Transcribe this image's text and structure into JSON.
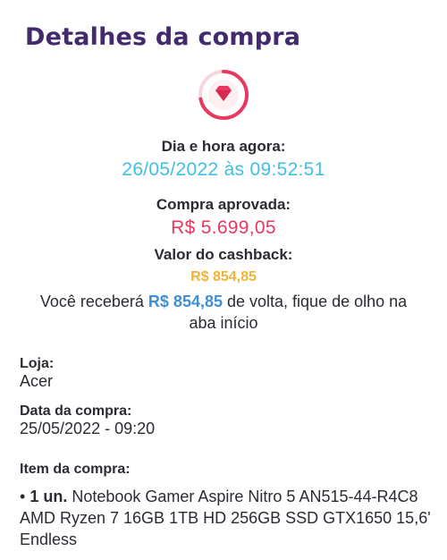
{
  "header": {
    "title": "Detalhes da compra"
  },
  "status_icon": {
    "name": "diamond-progress-icon",
    "color": "#e8385f",
    "track_color": "#f6d6dd",
    "progress": 0.72
  },
  "now": {
    "label": "Dia e hora agora:",
    "value": "26/05/2022 às 09:52:51",
    "color": "#3fc0e4"
  },
  "approved": {
    "label": "Compra aprovada:",
    "value": "R$ 5.699,05",
    "color": "#e8385f"
  },
  "cashback": {
    "label": "Valor do cashback:",
    "value": "R$ 854,85",
    "color": "#f2b336",
    "message_prefix": "Você receberá ",
    "message_amount": "R$ 854,85",
    "message_suffix": " de volta, fique de olho na aba início"
  },
  "store": {
    "label": "Loja:",
    "value": "Acer"
  },
  "purchase_date": {
    "label": "Data da compra:",
    "value": "25/05/2022 - 09:20"
  },
  "items": {
    "label": "Item da compra:",
    "list": [
      {
        "bullet": "• ",
        "qty": "1 un.",
        "name": " Notebook Gamer Aspire Nitro 5 AN515-44-R4C8 AMD Ryzen 7 16GB 1TB HD 256GB SSD GTX1650 15,6' Endless"
      }
    ]
  }
}
